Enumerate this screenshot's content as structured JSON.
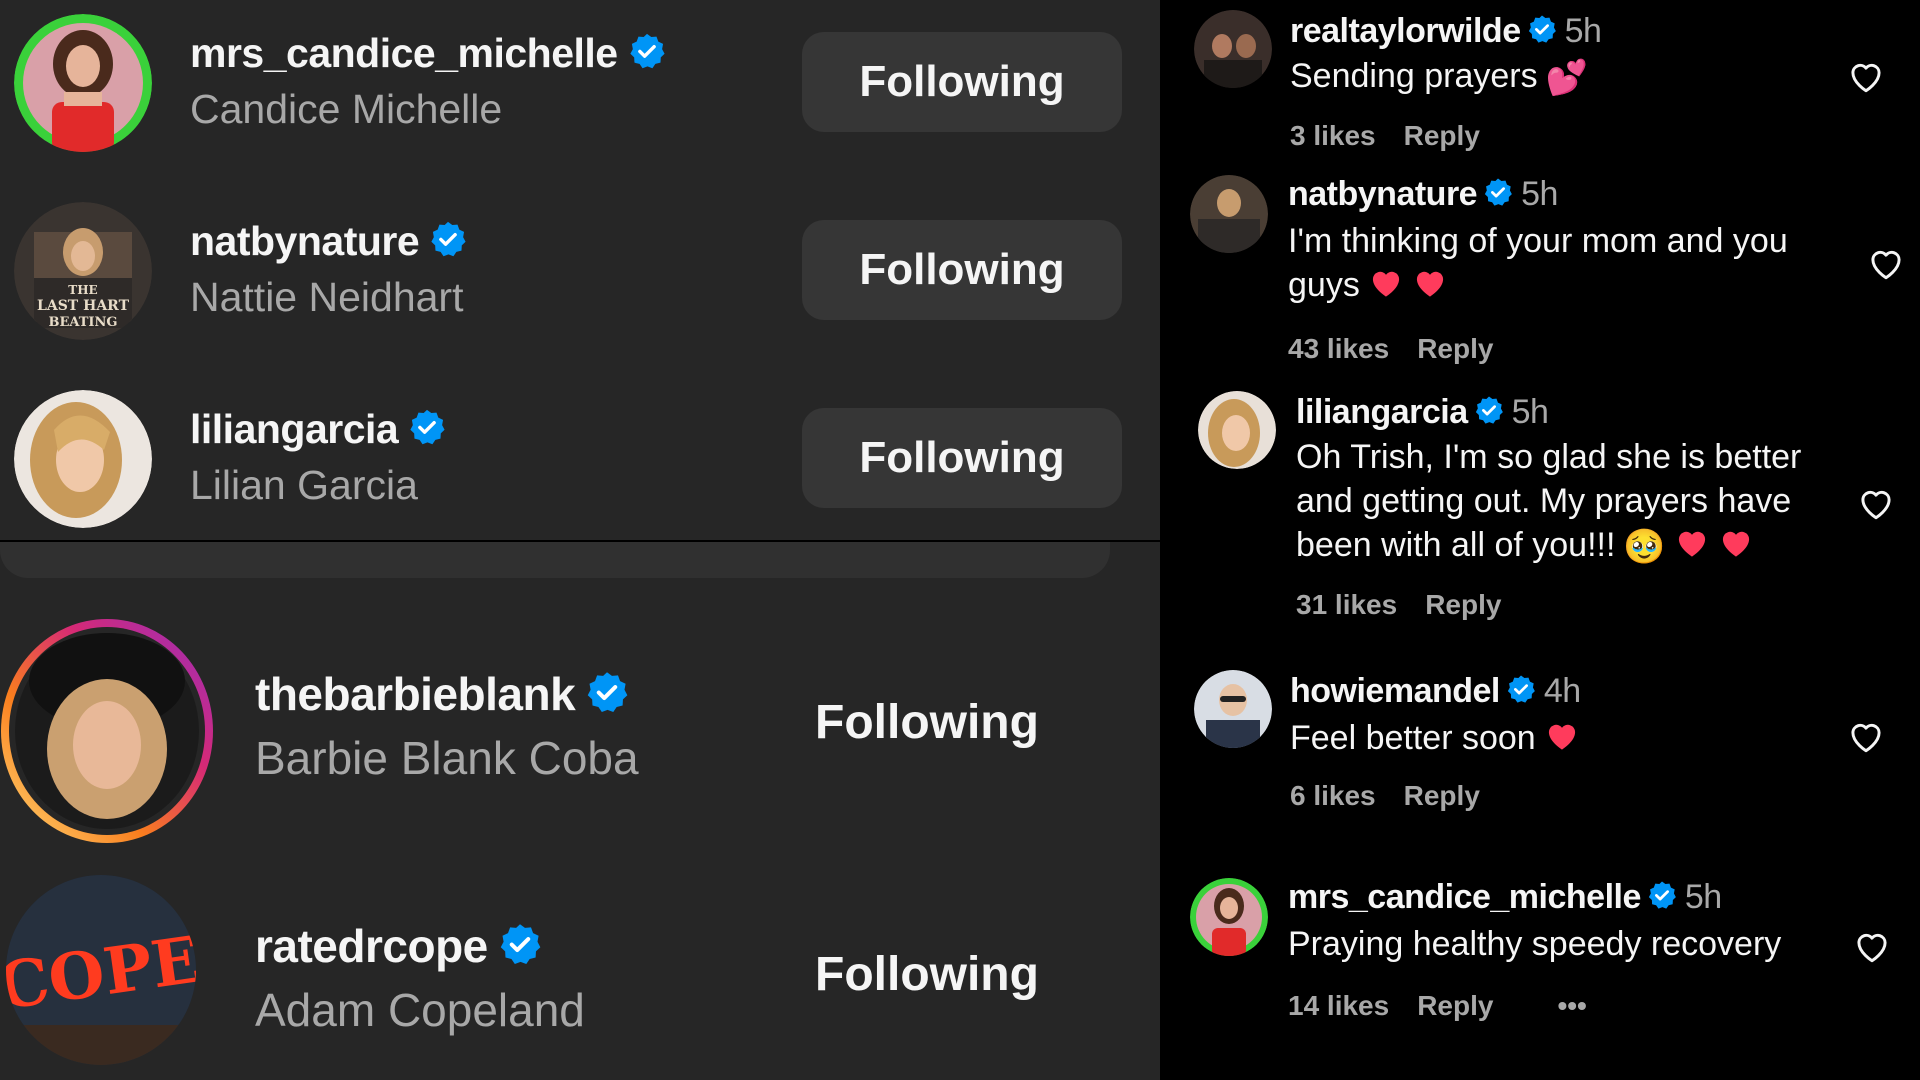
{
  "following_list_top": [
    {
      "username": "mrs_candice_michelle",
      "display_name": "Candice Michelle",
      "button": "Following",
      "avatar_color": "#3ad13a"
    },
    {
      "username": "natbynature",
      "display_name": "Nattie Neidhart",
      "button": "Following",
      "avatar_color": "#6b5a4a"
    },
    {
      "username": "liliangarcia",
      "display_name": "Lilian Garcia",
      "button": "Following",
      "avatar_color": "#c9a57a"
    }
  ],
  "following_list_bottom": [
    {
      "username": "thebarbieblank",
      "display_name": "Barbie Blank Coba",
      "button": "Following"
    },
    {
      "username": "ratedrcope",
      "display_name": "Adam Copeland",
      "button": "Following"
    }
  ],
  "avatar_texts": {
    "nat_book_line1": "THE",
    "nat_book_line2": "LAST HART",
    "nat_book_line3": "BEATING",
    "cope_sign": "COPE"
  },
  "comments": [
    {
      "username": "realtaylorwilde",
      "time": "5h",
      "text": "Sending prayers",
      "emoji": "💕",
      "likes": "3 likes",
      "reply": "Reply"
    },
    {
      "username": "natbynature",
      "time": "5h",
      "text": "I'm thinking of your mom and you guys",
      "likes": "43 likes",
      "reply": "Reply"
    },
    {
      "username": "liliangarcia",
      "time": "5h",
      "text": "Oh Trish, I'm so glad she is better and getting out. My prayers have been with all of you!!!",
      "emoji": "🥹",
      "likes": "31 likes",
      "reply": "Reply"
    },
    {
      "username": "howiemandel",
      "time": "4h",
      "text": "Feel better soon",
      "likes": "6 likes",
      "reply": "Reply"
    },
    {
      "username": "mrs_candice_michelle",
      "time": "5h",
      "text": "Praying healthy speedy recovery",
      "likes": "14 likes",
      "reply": "Reply",
      "more": "•••"
    }
  ],
  "colors": {
    "panel_bg": "#262626",
    "button_bg": "#363636",
    "verified_blue": "#0095f6",
    "heart_red": "#ff3040",
    "muted_text": "#a8a8a8"
  }
}
